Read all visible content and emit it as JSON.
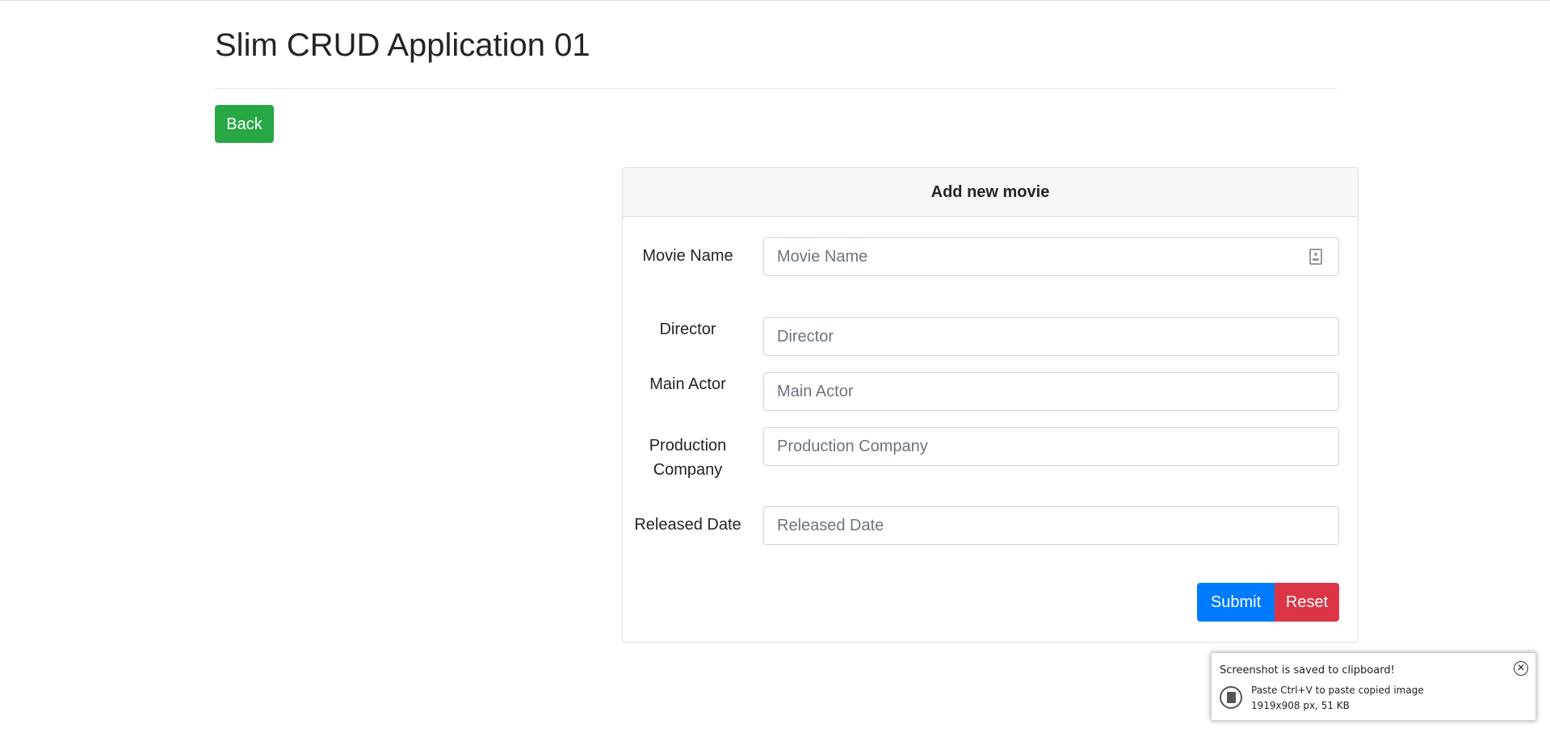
{
  "page": {
    "title": "Slim CRUD Application 01",
    "back_label": "Back"
  },
  "form": {
    "header": "Add new movie",
    "fields": [
      {
        "label": "Movie Name",
        "placeholder": "Movie Name",
        "value": ""
      },
      {
        "label": "Director",
        "placeholder": "Director",
        "value": ""
      },
      {
        "label": "Main Actor",
        "placeholder": "Main Actor",
        "value": ""
      },
      {
        "label": "Production Company",
        "placeholder": "Production Company",
        "value": ""
      },
      {
        "label": "Released Date",
        "placeholder": "Released Date",
        "value": ""
      }
    ],
    "submit_label": "Submit",
    "reset_label": "Reset"
  },
  "toast": {
    "title": "Screenshot is saved to clipboard!",
    "close_icon": "close-circle-icon",
    "line1": "Paste Ctrl+V to paste copied image",
    "line2": "1919x908 px, 51 KB"
  },
  "colors": {
    "success": "#28a745",
    "primary": "#007bff",
    "danger": "#dc3545"
  }
}
